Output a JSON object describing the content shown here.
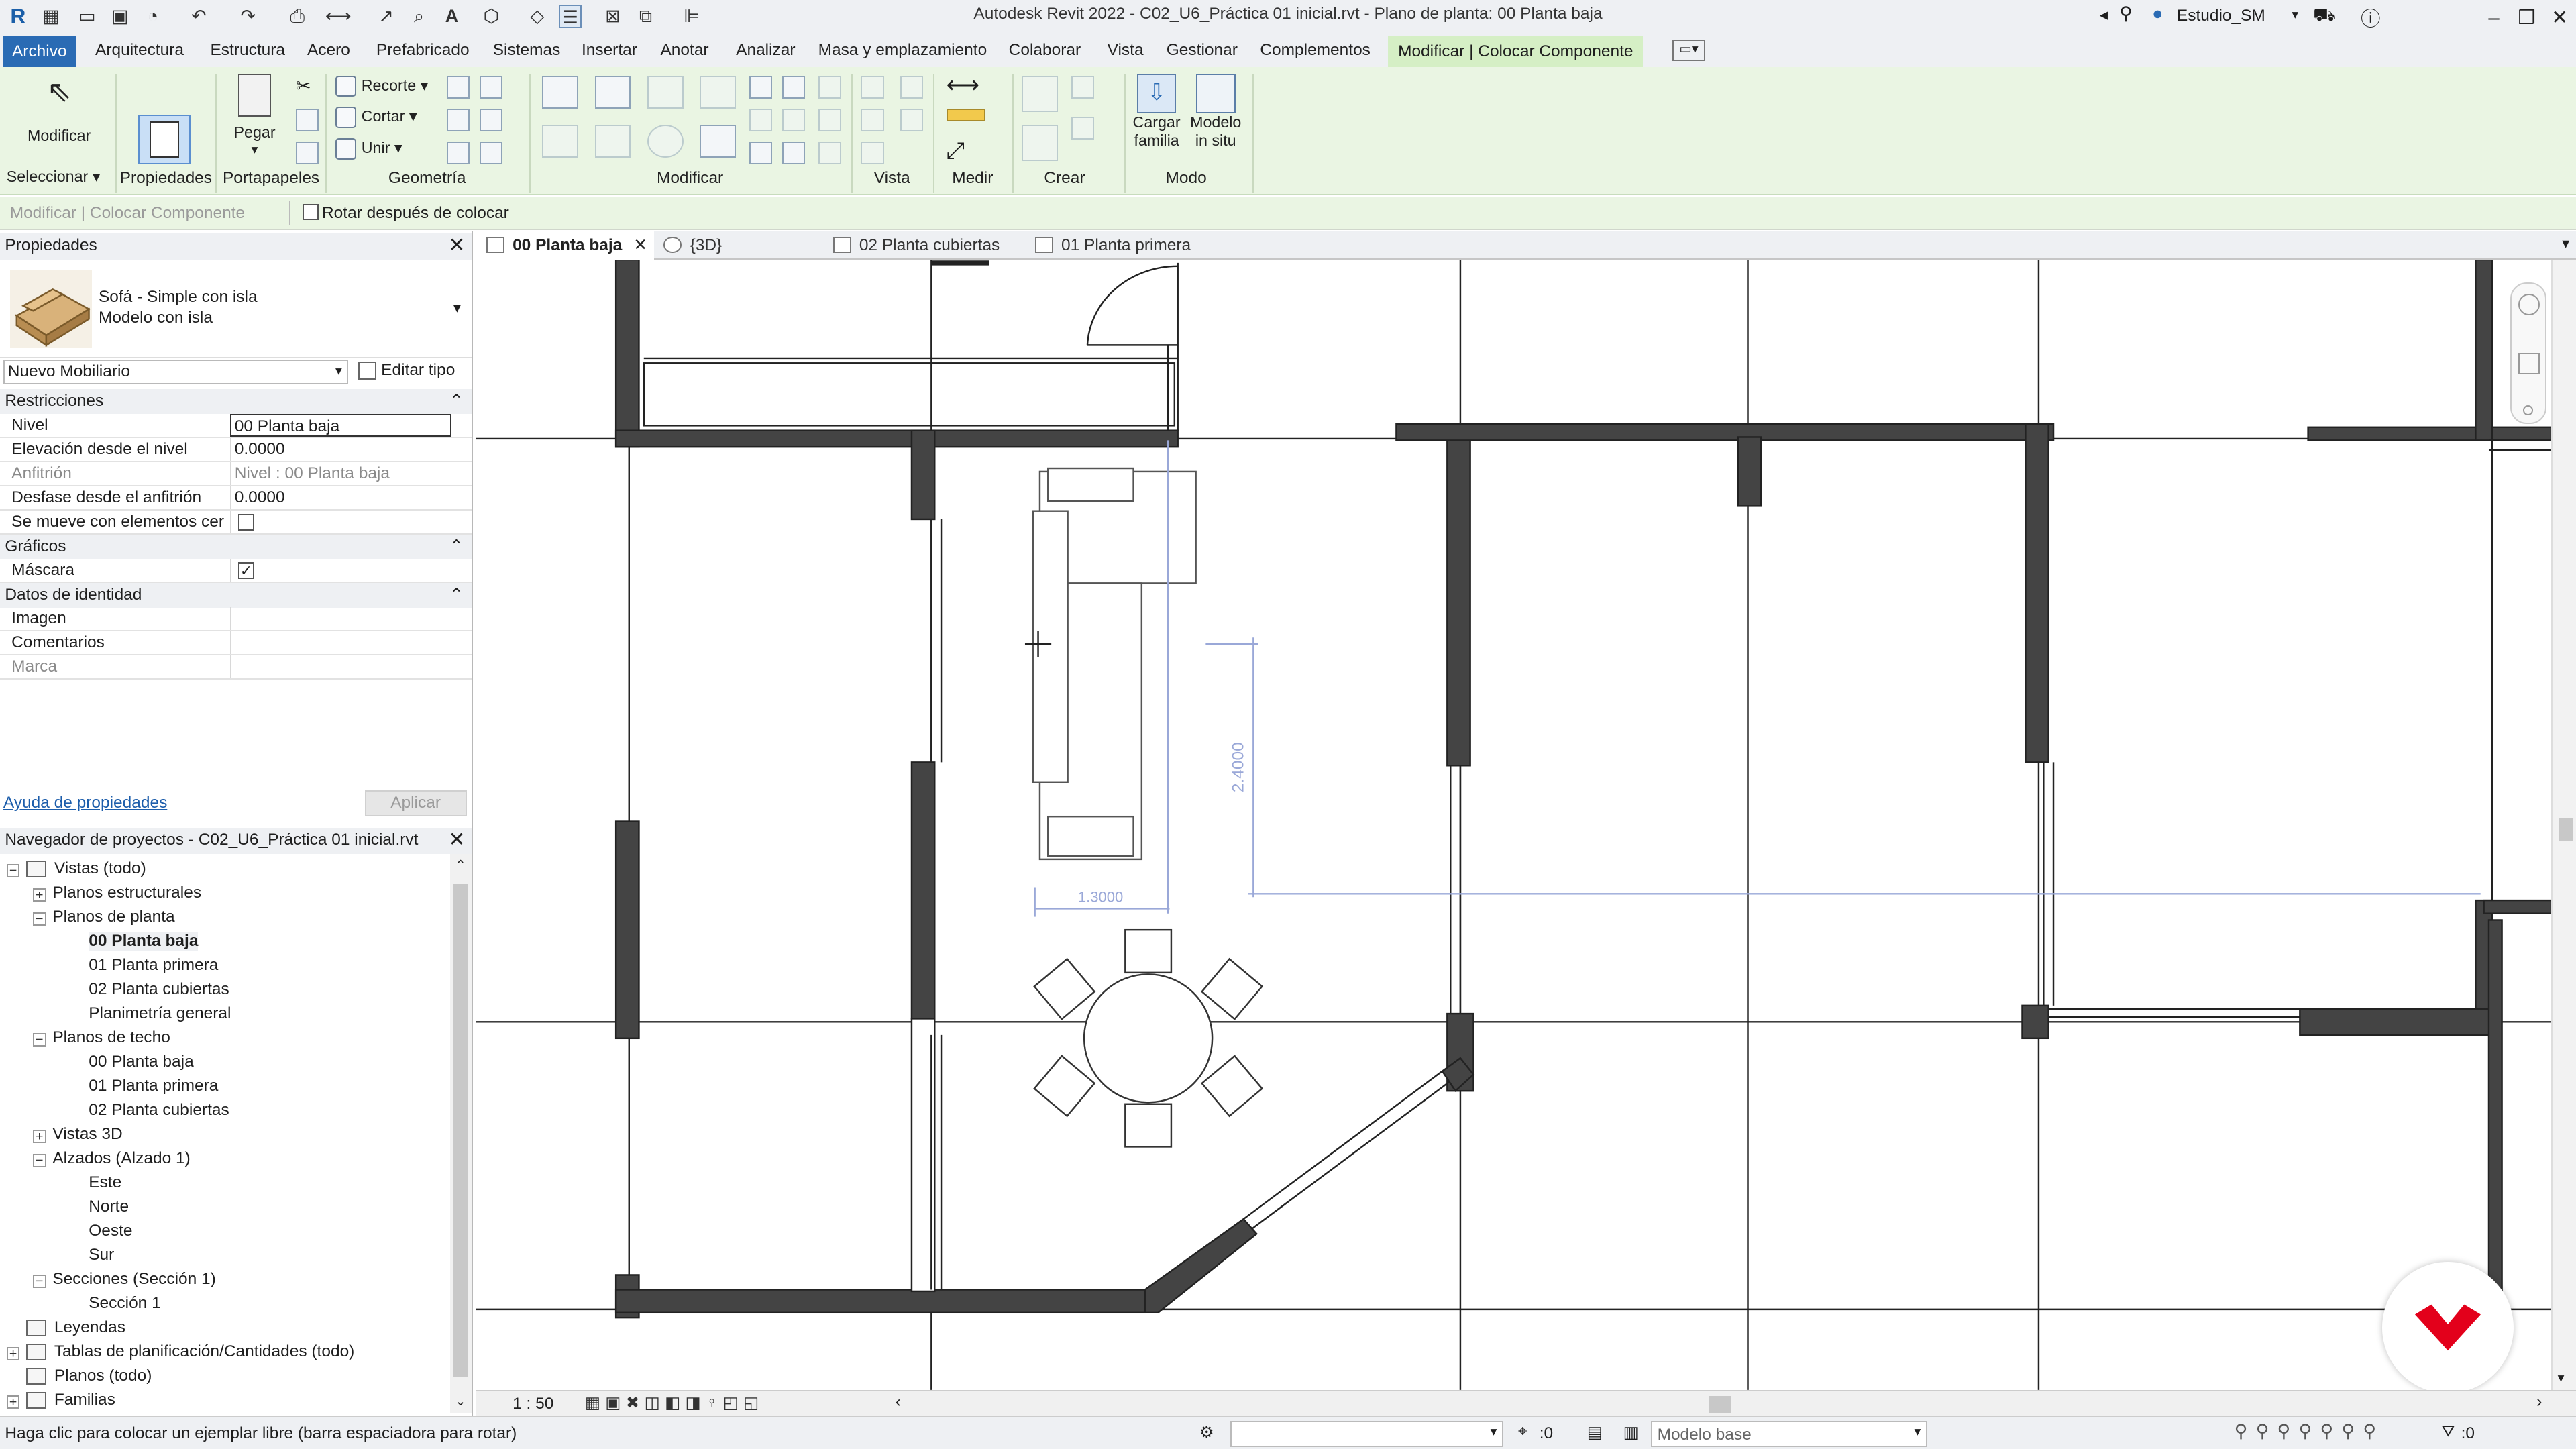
{
  "window": {
    "title": "Autodesk Revit 2022 - C02_U6_Práctica 01 inicial.rvt - Plano de planta: 00 Planta baja",
    "user": "Estudio_SM",
    "min_glyph": "–",
    "restore_glyph": "❐",
    "close_glyph": "✕"
  },
  "menu": {
    "file": "Archivo",
    "items": [
      "Arquitectura",
      "Estructura",
      "Acero",
      "Prefabricado",
      "Sistemas",
      "Insertar",
      "Anotar",
      "Analizar",
      "Masa y emplazamiento",
      "Colaborar",
      "Vista",
      "Gestionar",
      "Complementos"
    ],
    "active": "Modificar | Colocar Componente"
  },
  "ribbon": {
    "modify": "Modificar",
    "select": "Seleccionar",
    "properties": "Propiedades",
    "paste": "Pegar",
    "clipboard": "Portapapeles",
    "cope": "Recorte",
    "cut": "Cortar",
    "join": "Unir",
    "geometry": "Geometría",
    "modify_group": "Modificar",
    "view": "Vista",
    "measure": "Medir",
    "create": "Crear",
    "load_family_1": "Cargar",
    "load_family_2": "familia",
    "in_place_1": "Modelo",
    "in_place_2": "in situ",
    "mode": "Modo"
  },
  "options_bar": {
    "context": "Modificar | Colocar Componente",
    "rotate_after": "Rotar después de colocar"
  },
  "properties": {
    "panel_title": "Propiedades",
    "type_name": "Sofá - Simple con isla",
    "type_sub": "Modelo con isla",
    "filter": "Nuevo Mobiliario",
    "edit_type": "Editar tipo",
    "sections": {
      "constraints": "Restricciones",
      "graphics": "Gráficos",
      "identity": "Datos de identidad"
    },
    "rows": {
      "level_label": "Nivel",
      "level_value": "00 Planta baja",
      "elev_label": "Elevación desde el nivel",
      "elev_value": "0.0000",
      "host_label": "Anfitrión",
      "host_value": "Nivel : 00 Planta baja",
      "offset_label": "Desfase desde el anfitrión",
      "offset_value": "0.0000",
      "moves_label": "Se mueve con elementos cer...",
      "mask_label": "Máscara",
      "image_label": "Imagen",
      "comments_label": "Comentarios",
      "mark_label": "Marca"
    },
    "help": "Ayuda de propiedades",
    "apply": "Aplicar"
  },
  "browser": {
    "title": "Navegador de proyectos - C02_U6_Práctica 01 inicial.rvt",
    "nodes": [
      {
        "label": "Vistas (todo)",
        "level": 0,
        "toggle": "−",
        "icon": true
      },
      {
        "label": "Planos estructurales",
        "level": 1,
        "toggle": "+"
      },
      {
        "label": "Planos de planta",
        "level": 1,
        "toggle": "−"
      },
      {
        "label": "00 Planta baja",
        "level": 2,
        "bold": true
      },
      {
        "label": "01 Planta primera",
        "level": 2
      },
      {
        "label": "02 Planta cubiertas",
        "level": 2
      },
      {
        "label": "Planimetría general",
        "level": 2
      },
      {
        "label": "Planos de techo",
        "level": 1,
        "toggle": "−"
      },
      {
        "label": "00 Planta baja",
        "level": 2
      },
      {
        "label": "01 Planta primera",
        "level": 2
      },
      {
        "label": "02 Planta cubiertas",
        "level": 2
      },
      {
        "label": "Vistas 3D",
        "level": 1,
        "toggle": "+"
      },
      {
        "label": "Alzados (Alzado 1)",
        "level": 1,
        "toggle": "−"
      },
      {
        "label": "Este",
        "level": 2
      },
      {
        "label": "Norte",
        "level": 2
      },
      {
        "label": "Oeste",
        "level": 2
      },
      {
        "label": "Sur",
        "level": 2
      },
      {
        "label": "Secciones (Sección 1)",
        "level": 1,
        "toggle": "−"
      },
      {
        "label": "Sección 1",
        "level": 2
      },
      {
        "label": "Leyendas",
        "level": 0,
        "icon": true
      },
      {
        "label": "Tablas de planificación/Cantidades (todo)",
        "level": 0,
        "toggle": "+",
        "icon": true
      },
      {
        "label": "Planos (todo)",
        "level": 0,
        "icon": true
      },
      {
        "label": "Familias",
        "level": 0,
        "toggle": "+",
        "icon": true
      }
    ]
  },
  "tabs": [
    {
      "label": "00 Planta baja",
      "active": true
    },
    {
      "label": "{3D}"
    },
    {
      "label": "02 Planta cubiertas"
    },
    {
      "label": "01 Planta primera"
    }
  ],
  "drawing": {
    "dim_vertical": "2.4000",
    "dim_horizontal": "1.3000"
  },
  "view_control": {
    "scale": "1 : 50"
  },
  "status": {
    "hint": "Haga clic para colocar un ejemplar libre (barra espaciadora para rotar)",
    "sel_count": ":0",
    "model": "Modelo base",
    "filter_count": ":0"
  },
  "colors": {
    "ribbon_bg": "#eaf5e3",
    "file_tab": "#2a6bb4",
    "dimension": "#9aa8d8",
    "brand_red": "#e3001b"
  }
}
